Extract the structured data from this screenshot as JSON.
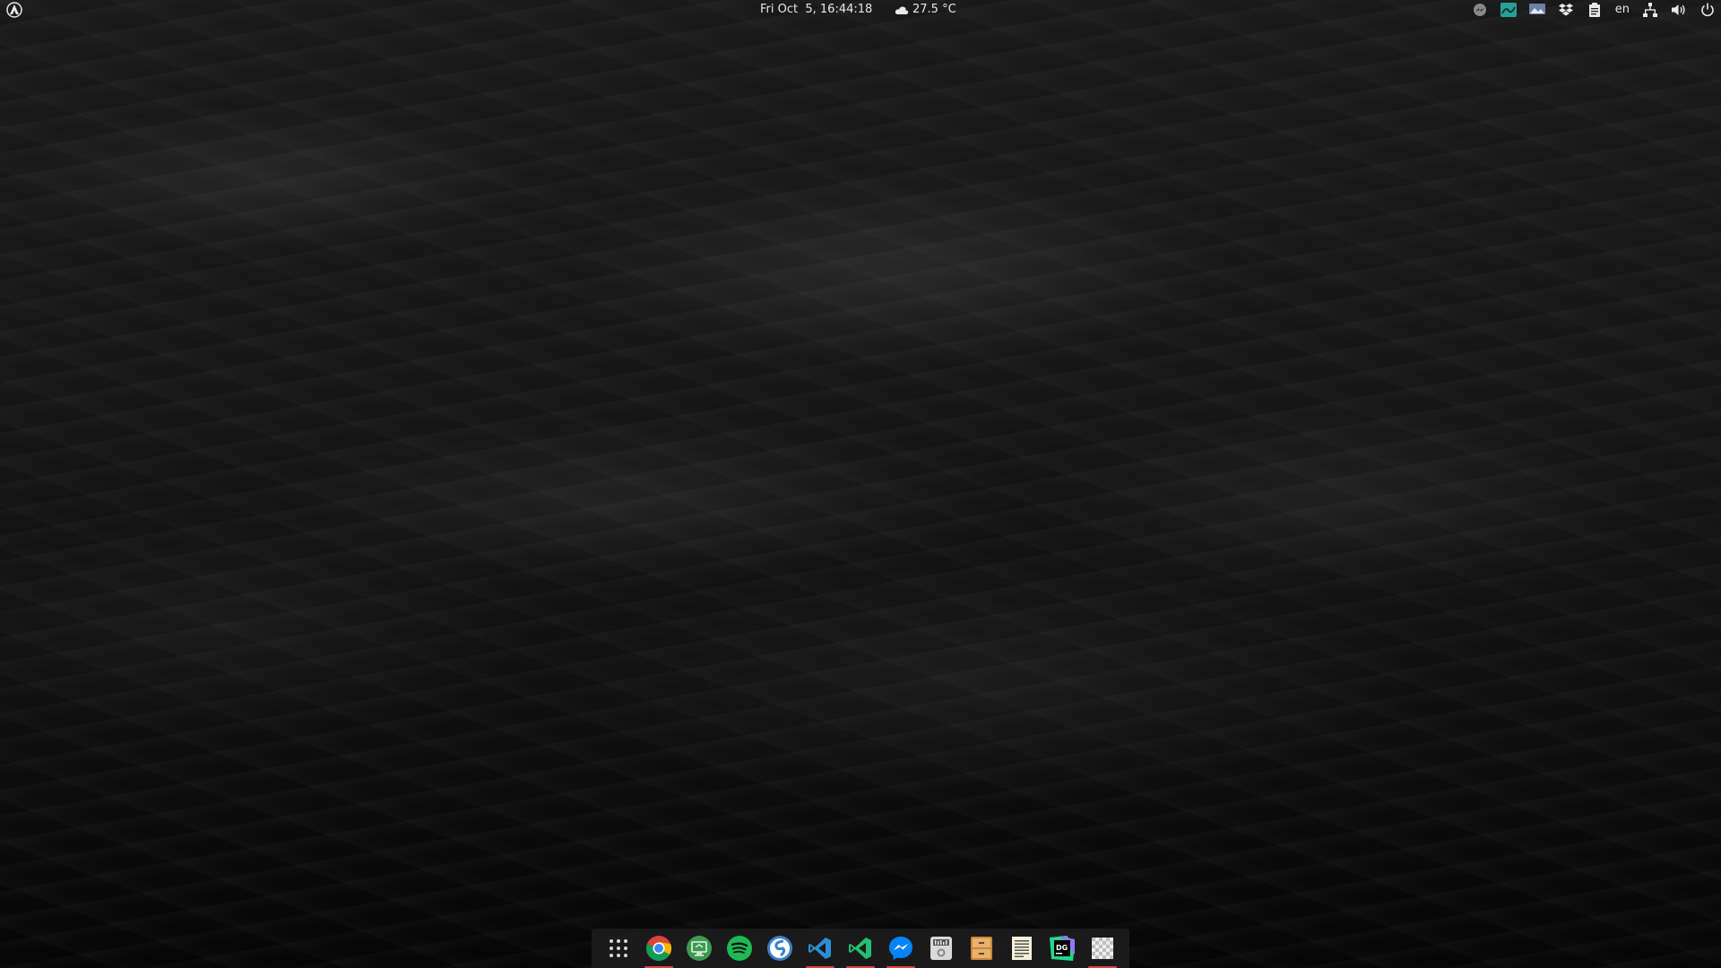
{
  "top_bar": {
    "clock": "Fri Oct  5, 16:44:18",
    "weather_temp": "27.5 °C",
    "weather_icon": "cloud-icon",
    "language": "en",
    "tray_icons": [
      "messenger-icon",
      "screen-recorder-icon",
      "display-icon",
      "dropbox-icon",
      "clipboard-icon",
      "network-icon",
      "volume-icon",
      "power-icon"
    ]
  },
  "dock": {
    "items": [
      {
        "name": "show-applications",
        "running": false
      },
      {
        "name": "google-chrome",
        "running": true
      },
      {
        "name": "remote-desktop",
        "running": false
      },
      {
        "name": "spotify",
        "running": false
      },
      {
        "name": "simplenote",
        "running": false
      },
      {
        "name": "visual-studio-code",
        "running": true
      },
      {
        "name": "visual-studio-code-insiders",
        "running": true
      },
      {
        "name": "messenger",
        "running": true
      },
      {
        "name": "sound-recorder",
        "running": false
      },
      {
        "name": "file-cabinet",
        "running": false
      },
      {
        "name": "text-editor",
        "running": false
      },
      {
        "name": "datagrip",
        "running": false
      },
      {
        "name": "image-viewer",
        "running": true
      }
    ],
    "datagrip_label": "DG"
  },
  "colors": {
    "running_indicator": "#e0423c",
    "chrome_red": "#db4437",
    "chrome_yellow": "#f4b400",
    "chrome_green": "#0f9d58",
    "chrome_blue": "#4285f4",
    "spotify": "#1db954",
    "messenger": "#0084ff",
    "vscode": "#2c8fd6",
    "vscode_insiders": "#24bf71"
  }
}
